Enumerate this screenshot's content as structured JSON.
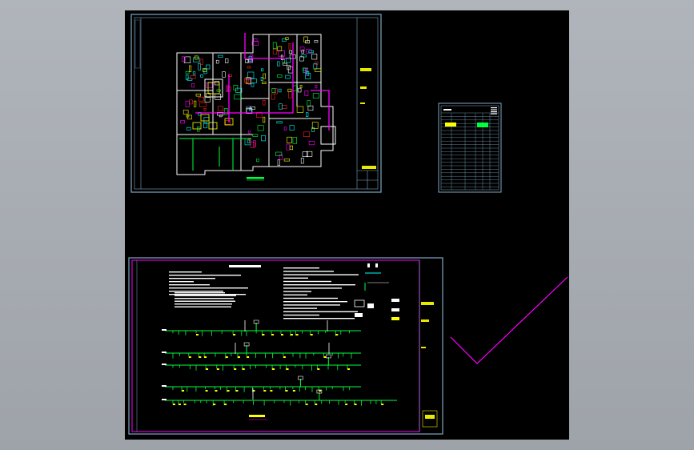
{
  "viewport": {
    "background_color": "#a6abb1",
    "canvas_color": "#000000"
  },
  "colors": {
    "frame": "#7fa8c0",
    "wall": "#ffffff",
    "magenta": "#ff00ff",
    "green": "#00ff3c",
    "yellow": "#ffff00",
    "cyan": "#00ffff",
    "red": "#ff2020"
  },
  "sheets": [
    {
      "name": "floor-plan-sheet"
    },
    {
      "name": "materials-table-sheet"
    },
    {
      "name": "system-diagram-sheet"
    }
  ],
  "labels": {
    "plan_title": "一层给排水平面图",
    "diagram_title": "给排水设计说明",
    "legend_title": "图 例",
    "table_header": "序 号"
  }
}
